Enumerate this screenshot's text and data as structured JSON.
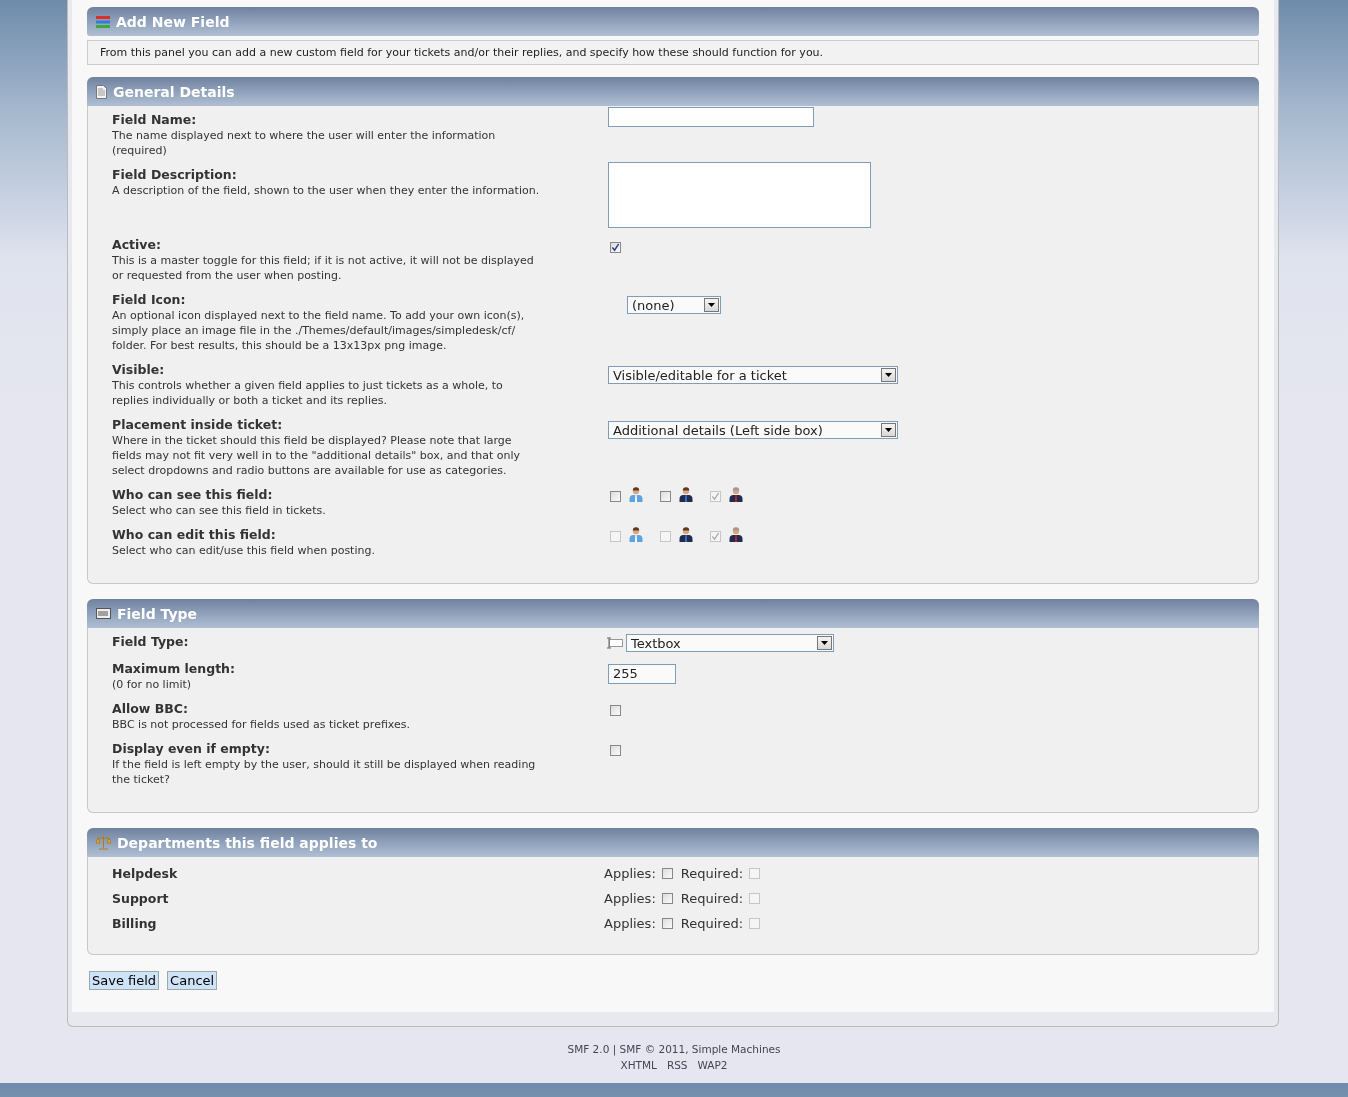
{
  "title_bar": {
    "title": "Add New Field"
  },
  "intro": "From this panel you can add a new custom field for your tickets and/or their replies, and specify how these should function for you.",
  "sections": [
    {
      "kind": "form",
      "title": "General Details",
      "rows": [
        {
          "label": "Field Name:",
          "description": "The name displayed next to where the user will enter the information (required)",
          "control": {
            "kind": "text"
          }
        },
        {
          "label": "Field Description:",
          "description": "A description of the field, shown to the user when they enter the information.",
          "control": {
            "kind": "textarea"
          }
        },
        {
          "label": "Active:",
          "description": "This is a master toggle for this field; if it is not active, it will not be displayed or requested from the user when posting.",
          "control": {
            "kind": "checkbox",
            "checked": true
          }
        },
        {
          "label": "Field Icon:",
          "description": "An optional icon displayed next to the field name. To add your own icon(s), simply place an image file in the ./Themes/default/images/simpledesk/cf/ folder. For best results, this should be a 13x13px png image.",
          "control": {
            "kind": "icon-select",
            "value": "(none)"
          }
        },
        {
          "label": "Visible:",
          "description": "This controls whether a given field applies to just tickets as a whole, to replies individually or both a ticket and its replies.",
          "control": {
            "kind": "select",
            "value": "Visible/editable for a ticket"
          }
        },
        {
          "label": "Placement inside ticket:",
          "description": "Where in the ticket should this field be displayed? Please note that large fields may not fit very well in to the \"additional details\" box, and that only select dropdowns and radio buttons are available for use as categories.",
          "control": {
            "kind": "select",
            "value": "Additional details (Left side box)"
          }
        },
        {
          "label": "Who can see this field:",
          "description": "Select who can see this field in tickets.",
          "control": {
            "kind": "roles",
            "options": [
              {
                "checked": false,
                "disabled": false
              },
              {
                "checked": false,
                "disabled": false
              },
              {
                "checked": true,
                "disabled": true
              }
            ]
          }
        },
        {
          "label": "Who can edit this field:",
          "description": "Select who can edit/use this field when posting.",
          "control": {
            "kind": "roles",
            "options": [
              {
                "checked": false,
                "disabled": true
              },
              {
                "checked": false,
                "disabled": true
              },
              {
                "checked": true,
                "disabled": true
              }
            ]
          }
        }
      ]
    },
    {
      "kind": "form",
      "title": "Field Type",
      "rows": [
        {
          "label": "Field Type:",
          "control": {
            "kind": "type-select",
            "value": "Textbox"
          }
        },
        {
          "label": "Maximum length:",
          "description": "(0 for no limit)",
          "control": {
            "kind": "short-text",
            "value": "255"
          }
        },
        {
          "label": "Allow BBC:",
          "description": "BBC is not processed for fields used as ticket prefixes.",
          "control": {
            "kind": "checkbox",
            "checked": false
          }
        },
        {
          "label": "Display even if empty:",
          "description": "If the field is left empty by the user, should it still be displayed when reading the ticket?",
          "control": {
            "kind": "checkbox",
            "checked": false
          }
        }
      ]
    },
    {
      "kind": "departments",
      "title": "Departments this field applies to",
      "departments": [
        {
          "name": "Helpdesk",
          "applies_label": "Applies:",
          "applies": false,
          "required_label": "Required:",
          "required": false,
          "required_disabled": true
        },
        {
          "name": "Support",
          "applies_label": "Applies:",
          "applies": false,
          "required_label": "Required:",
          "required": false,
          "required_disabled": true
        },
        {
          "name": "Billing",
          "applies_label": "Applies:",
          "applies": false,
          "required_label": "Required:",
          "required": false,
          "required_disabled": true
        }
      ]
    }
  ],
  "buttons": [
    "Save field",
    "Cancel"
  ],
  "footer": {
    "line": "SMF 2.0 | SMF © 2011, Simple Machines",
    "links": [
      "XHTML",
      "RSS",
      "WAP2"
    ]
  }
}
